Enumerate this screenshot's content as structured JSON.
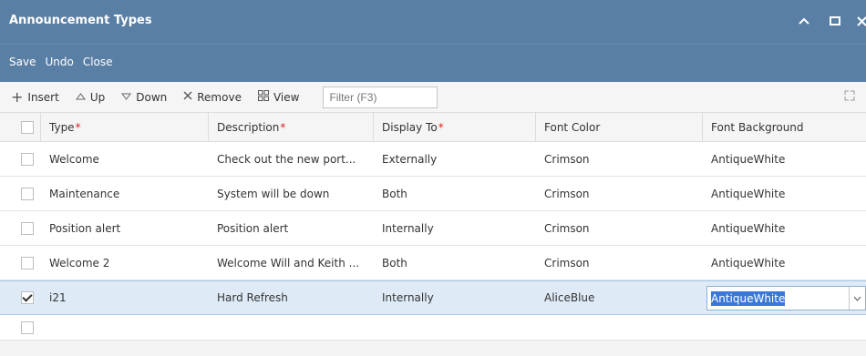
{
  "window": {
    "title": "Announcement Types"
  },
  "menu": {
    "save": "Save",
    "undo": "Undo",
    "close": "Close"
  },
  "toolbar": {
    "insert": "Insert",
    "up": "Up",
    "down": "Down",
    "remove": "Remove",
    "view": "View",
    "filter_placeholder": "Filter (F3)"
  },
  "grid": {
    "columns": [
      "Type",
      "Description",
      "Display To",
      "Font Color",
      "Font Background"
    ],
    "required_marker": "*",
    "rows": [
      {
        "type": "Welcome",
        "description": "Check out the new port...",
        "display_to": "Externally",
        "font_color": "Crimson",
        "font_background": "AntiqueWhite",
        "checked": false
      },
      {
        "type": "Maintenance",
        "description": "System will be down",
        "display_to": "Both",
        "font_color": "Crimson",
        "font_background": "AntiqueWhite",
        "checked": false
      },
      {
        "type": "Position alert",
        "description": "Position alert",
        "display_to": "Internally",
        "font_color": "Crimson",
        "font_background": "AntiqueWhite",
        "checked": false
      },
      {
        "type": "Welcome 2",
        "description": "Welcome Will and Keith ...",
        "display_to": "Both",
        "font_color": "Crimson",
        "font_background": "AntiqueWhite",
        "checked": false
      },
      {
        "type": "i21",
        "description": "Hard Refresh",
        "display_to": "Internally",
        "font_color": "AliceBlue",
        "font_background": "AntiqueWhite",
        "checked": true
      }
    ]
  },
  "colors": {
    "titlebar": "#5a7fa5",
    "selected_row": "#deebf7",
    "required": "#e02424",
    "selection": "#3a78d8"
  },
  "icons": {
    "insert": "plus-icon",
    "up": "triangle-up-icon",
    "down": "triangle-down-icon",
    "remove": "x-icon",
    "view": "grid-view-icon",
    "expand": "expand-icon",
    "minimize": "chevron-up-icon",
    "maximize": "maximize-icon",
    "close": "close-icon"
  }
}
